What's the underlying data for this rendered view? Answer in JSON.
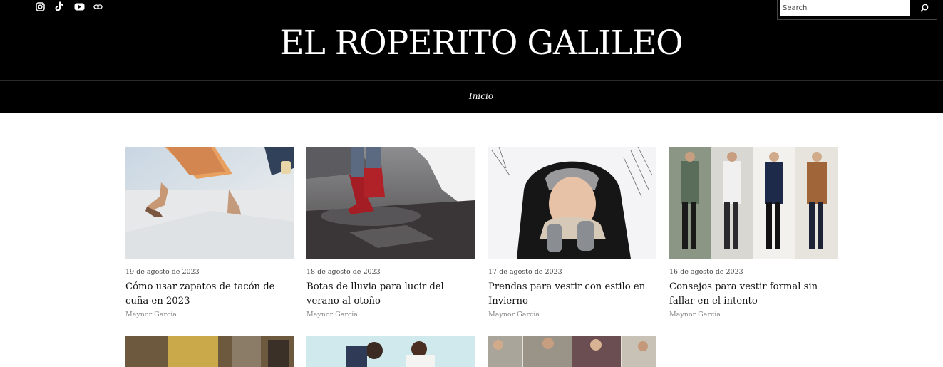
{
  "site": {
    "title": "EL ROPERITO GALILEO"
  },
  "social": [
    {
      "name": "instagram-icon"
    },
    {
      "name": "tiktok-icon"
    },
    {
      "name": "youtube-icon"
    },
    {
      "name": "link-icon"
    }
  ],
  "search": {
    "placeholder": "Search"
  },
  "nav": {
    "items": [
      {
        "label": "Inicio"
      }
    ]
  },
  "posts": [
    {
      "date": "19 de agosto de 2023",
      "title": "Cómo usar zapatos de tacón de cuña en 2023",
      "author": "Maynor García"
    },
    {
      "date": "18 de agosto de 2023",
      "title": "Botas de lluvia para lucir del verano al otoño",
      "author": "Maynor García"
    },
    {
      "date": "17 de agosto de 2023",
      "title": "Prendas para vestir con estilo en Invierno",
      "author": "Maynor García"
    },
    {
      "date": "16 de agosto de 2023",
      "title": "Consejos para vestir formal sin fallar en el intento",
      "author": "Maynor García"
    }
  ],
  "colors": {
    "header_bg": "#000000",
    "text": "#111111",
    "muted": "#888888"
  }
}
